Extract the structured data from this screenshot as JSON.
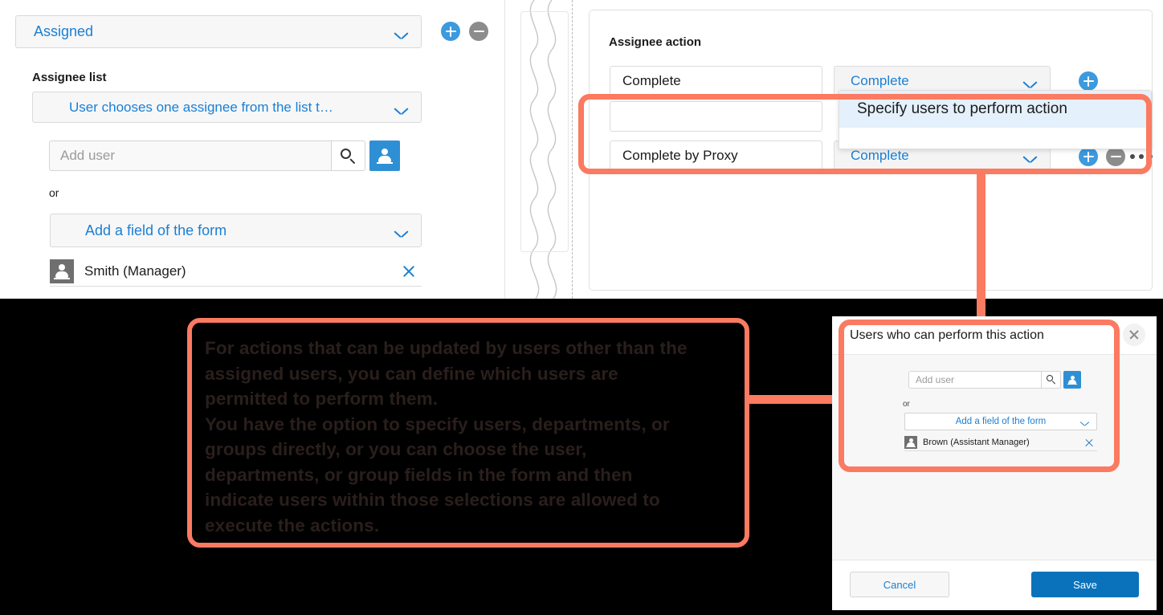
{
  "left_panel": {
    "assigned_select": {
      "value": "Assigned",
      "icon": "chevron-down-icon"
    },
    "add_button_icon": "plus-circle-icon",
    "remove_button_icon": "minus-circle-icon",
    "assignee_list_title": "Assignee list",
    "assignee_mode_select": {
      "value": "User chooses one assignee from the list t…"
    },
    "add_user": {
      "placeholder": "Add user",
      "search_icon": "search-icon",
      "user_picker_icon": "user-icon"
    },
    "or_label": "or",
    "add_field_select": {
      "value": "Add a field of the form"
    },
    "assignee_chip": {
      "name": "Smith (Manager)",
      "avatar_icon": "user-avatar-icon",
      "remove_icon": "close-x-icon"
    }
  },
  "right_panel": {
    "assignee_action_title": "Assignee action",
    "rows": [
      {
        "name": "Complete",
        "type": "Complete"
      },
      {
        "name": "",
        "type": ""
      },
      {
        "name": "Complete by Proxy",
        "type": "Complete"
      }
    ],
    "more_icon": "ellipsis-icon",
    "dropdown": {
      "options": [
        "Specify users to perform action"
      ]
    }
  },
  "annotation": {
    "text": "For actions that can be updated by users other than the assigned users, you can define which users are permitted to perform them.\nYou have the option to specify users, departments, or groups directly, or you can choose the user, departments, or group fields in the form and then indicate users within those selections are allowed to execute the actions.",
    "lines": [
      "For actions that can be updated by users other than the",
      "assigned users, you can define which users are",
      "permitted to perform them.",
      "You have the option to specify users, departments, or",
      "groups directly, or you can choose the user,",
      "departments, or group fields in the form and then",
      "indicate users within those selections are allowed to",
      "execute the actions."
    ]
  },
  "dialog": {
    "title": "Users who can perform this action",
    "close_icon": "close-icon",
    "add_user": {
      "placeholder": "Add user",
      "search_icon": "search-icon",
      "user_picker_icon": "user-icon"
    },
    "or_label": "or",
    "add_field_select": {
      "value": "Add a field of the form"
    },
    "user_chip": {
      "name": "Brown (Assistant Manager)",
      "avatar_icon": "user-avatar-icon",
      "remove_icon": "close-x-icon"
    },
    "cancel_label": "Cancel",
    "save_label": "Save"
  },
  "colors": {
    "accent_link": "#1a7fd4",
    "highlight": "#fb7a62",
    "primary_button": "#0a72bb",
    "annotation_bg": "#000000",
    "annotation_text": "#2a1f1c",
    "dropdown_highlight": "#e4f0fb"
  }
}
